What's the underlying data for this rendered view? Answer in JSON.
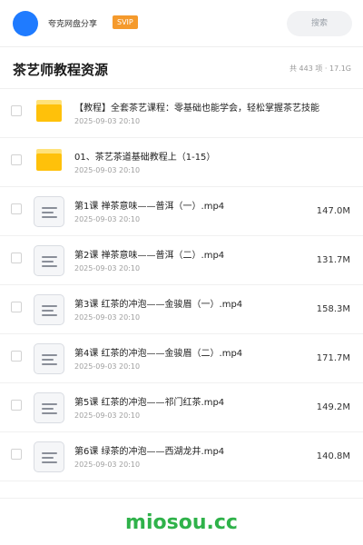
{
  "header": {
    "username": "夸克网盘分享",
    "badge": "SVIP",
    "search_label": "搜索",
    "accent": "#1f7bff",
    "badge_color": "#f59a2c"
  },
  "title_bar": {
    "title": "茶艺师教程资源",
    "summary": "共 443 项 · 17.1G"
  },
  "files": [
    {
      "kind": "folder",
      "name": "【教程】全套茶艺课程：零基础也能学会，轻松掌握茶艺技能",
      "date": "2025-09-03 20:10",
      "size": ""
    },
    {
      "kind": "folder",
      "name": "01、茶艺茶道基础教程上（1-15）",
      "date": "2025-09-03 20:10",
      "size": ""
    },
    {
      "kind": "file",
      "name": "第1课 禅茶意味——普洱（一）.mp4",
      "date": "2025-09-03 20:10",
      "size": "147.0M"
    },
    {
      "kind": "file",
      "name": "第2课 禅茶意味——普洱（二）.mp4",
      "date": "2025-09-03 20:10",
      "size": "131.7M"
    },
    {
      "kind": "file",
      "name": "第3课 红茶的冲泡——金骏眉（一）.mp4",
      "date": "2025-09-03 20:10",
      "size": "158.3M"
    },
    {
      "kind": "file",
      "name": "第4课 红茶的冲泡——金骏眉（二）.mp4",
      "date": "2025-09-03 20:10",
      "size": "171.7M"
    },
    {
      "kind": "file",
      "name": "第5课 红茶的冲泡——祁门红茶.mp4",
      "date": "2025-09-03 20:10",
      "size": "149.2M"
    },
    {
      "kind": "file",
      "name": "第6课 绿茶的冲泡——西湖龙井.mp4",
      "date": "2025-09-03 20:10",
      "size": "140.8M"
    }
  ],
  "watermark": "miosou.cc"
}
